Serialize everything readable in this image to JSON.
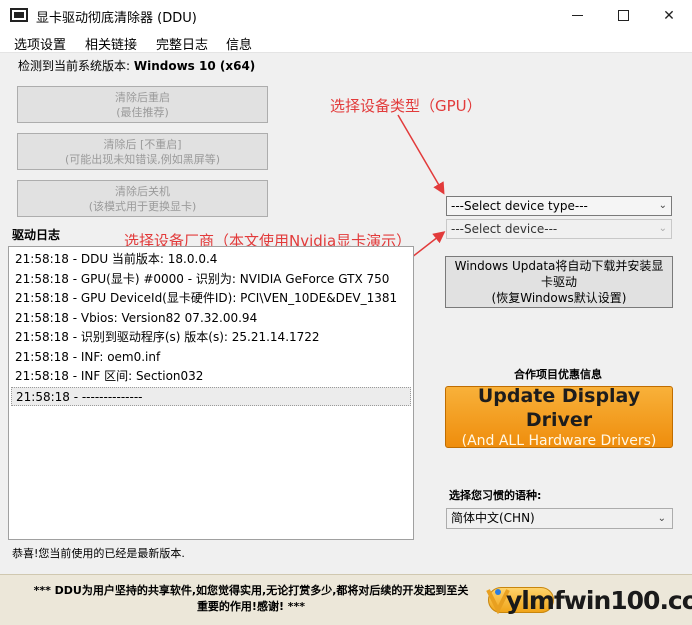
{
  "window": {
    "title": "显卡驱动彻底清除器 (DDU)"
  },
  "menu": [
    "选项设置",
    "相关链接",
    "完整日志",
    "信息"
  ],
  "detected": {
    "label": "检测到当前系统版本: ",
    "value": "Windows 10 (x64)"
  },
  "buttons": [
    {
      "line1": "清除后重启",
      "line2": "(最佳推荐)"
    },
    {
      "line1": "清除后 [不重启]",
      "line2": "(可能出现未知错误,例如黑屏等)"
    },
    {
      "line1": "清除后关机",
      "line2": "(该模式用于更换显卡)"
    }
  ],
  "annotations": {
    "device_type": "选择设备类型（GPU）",
    "vendor": "选择设备厂商（本文使用Nvidia显卡演示）"
  },
  "log": {
    "label": "驱动日志",
    "rows": [
      "21:58:18 - DDU 当前版本: 18.0.0.4",
      "21:58:18 - GPU(显卡) #0000 - 识别为: NVIDIA GeForce GTX 750",
      "21:58:18 - GPU DeviceId(显卡硬件ID): PCI\\VEN_10DE&DEV_1381",
      "21:58:18 - Vbios: Version82 07.32.00.94",
      "21:58:18 - 识别到驱动程序(s) 版本(s): 25.21.14.1722",
      "21:58:18 - INF: oem0.inf",
      "21:58:18 - INF 区间: Section032",
      "21:58:18 - --------------"
    ]
  },
  "selects": {
    "device_type": "---Select device type---",
    "device": "---Select device---"
  },
  "windows_update": {
    "line1": "Windows Updata将自动下载并安装显",
    "line2": "卡驱动",
    "line3": "(恢复Windows默认设置)"
  },
  "partner": {
    "label": "合作项目优惠信息"
  },
  "update_driver": {
    "title": "Update Display Driver",
    "subtitle": "(And ALL Hardware Drivers)"
  },
  "language": {
    "label": "选择您习惯的语种:",
    "value": "简体中文(CHN)"
  },
  "status": "恭喜!您当前使用的已经是最新版本.",
  "footer": {
    "line1": "*** DDU为用户坚持的共享软件,如您觉得实用,无论打赏多少,都将对后续的开发起到至关",
    "line2": "重要的作用!感谢! ***"
  },
  "watermark": "ylmfwin100.com",
  "colors": {
    "annotation": "#e23b3b",
    "update_button": "#f29a1c",
    "footer_bg": "#ece7d9"
  }
}
